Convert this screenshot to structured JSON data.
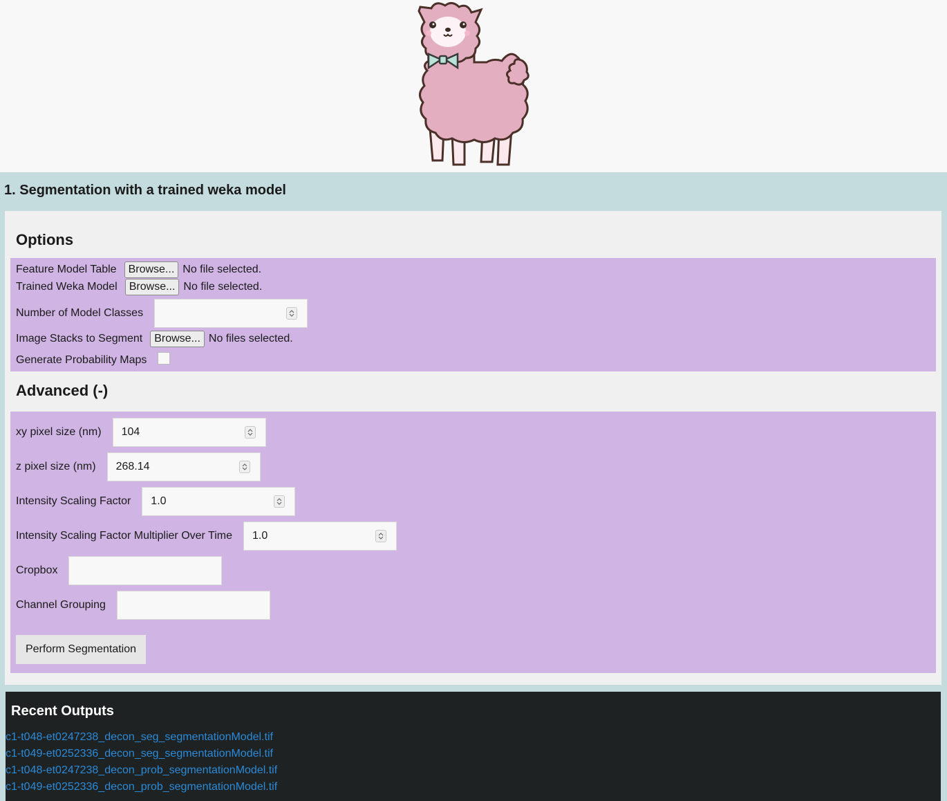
{
  "section": {
    "title": "1. Segmentation with a trained weka model"
  },
  "options": {
    "heading": "Options",
    "feature_model_table": {
      "label": "Feature Model Table",
      "button": "Browse...",
      "status": "No file selected."
    },
    "trained_weka_model": {
      "label": "Trained Weka Model",
      "button": "Browse...",
      "status": "No file selected."
    },
    "number_of_model_classes": {
      "label": "Number of Model Classes",
      "value": ""
    },
    "image_stacks": {
      "label": "Image Stacks to Segment",
      "button": "Browse...",
      "status": "No files selected."
    },
    "probability_maps": {
      "label": "Generate Probability Maps",
      "checked": false
    }
  },
  "advanced": {
    "heading": "Advanced (-)",
    "xy_pixel_size": {
      "label": "xy pixel size (nm)",
      "value": "104"
    },
    "z_pixel_size": {
      "label": "z pixel size (nm)",
      "value": "268.14"
    },
    "intensity_scaling": {
      "label": "Intensity Scaling Factor",
      "value": "1.0"
    },
    "intensity_multiplier": {
      "label": "Intensity Scaling Factor Multiplier Over Time",
      "value": "1.0"
    },
    "cropbox": {
      "label": "Cropbox",
      "value": ""
    },
    "channel_grouping": {
      "label": "Channel Grouping",
      "value": ""
    }
  },
  "actions": {
    "perform_label": "Perform Segmentation"
  },
  "recent_outputs": {
    "title": "Recent Outputs",
    "files": [
      "c1-t048-et0247238_decon_seg_segmentationModel.tif",
      "c1-t049-et0252336_decon_seg_segmentationModel.tif",
      "c1-t048-et0247238_decon_prob_segmentationModel.tif",
      "c1-t049-et0252336_decon_prob_segmentationModel.tif"
    ]
  },
  "colors": {
    "section_bg": "#c4dcde",
    "panel_bg": "#f0f0f0",
    "form_bg": "#d0b4e4",
    "outputs_bg": "#1f2222",
    "link": "#2a8ad8"
  },
  "icons": [
    "llama-logo",
    "spinner-icon"
  ]
}
